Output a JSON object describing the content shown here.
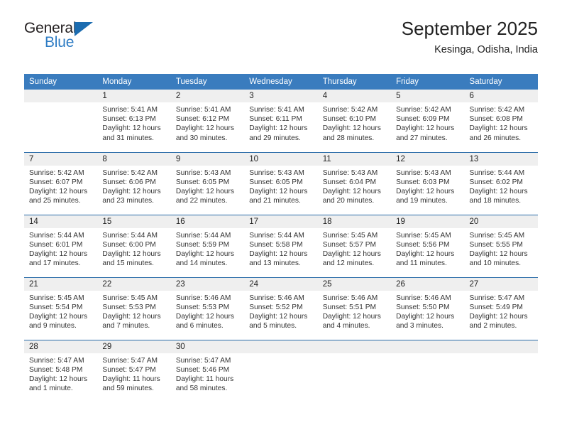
{
  "brand": {
    "name_part1": "General",
    "name_part2": "Blue",
    "triangle_color": "#1b6cb0",
    "blue_color": "#2e7cc4"
  },
  "header": {
    "title": "September 2025",
    "subtitle": "Kesinga, Odisha, India"
  },
  "theme": {
    "header_bg": "#3a7cbe",
    "daynum_bg": "#efefef",
    "week_divider": "#2b6ca8"
  },
  "weekday_headers": [
    "Sunday",
    "Monday",
    "Tuesday",
    "Wednesday",
    "Thursday",
    "Friday",
    "Saturday"
  ],
  "labels": {
    "sunrise_prefix": "Sunrise:",
    "sunset_prefix": "Sunset:",
    "daylight_prefix": "Daylight:"
  },
  "weeks": [
    [
      {
        "day": "",
        "blank": true,
        "l1": "",
        "l2": "",
        "l3": "",
        "l4": ""
      },
      {
        "day": "1",
        "l1": "Sunrise: 5:41 AM",
        "l2": "Sunset: 6:13 PM",
        "l3": "Daylight: 12 hours",
        "l4": "and 31 minutes."
      },
      {
        "day": "2",
        "l1": "Sunrise: 5:41 AM",
        "l2": "Sunset: 6:12 PM",
        "l3": "Daylight: 12 hours",
        "l4": "and 30 minutes."
      },
      {
        "day": "3",
        "l1": "Sunrise: 5:41 AM",
        "l2": "Sunset: 6:11 PM",
        "l3": "Daylight: 12 hours",
        "l4": "and 29 minutes."
      },
      {
        "day": "4",
        "l1": "Sunrise: 5:42 AM",
        "l2": "Sunset: 6:10 PM",
        "l3": "Daylight: 12 hours",
        "l4": "and 28 minutes."
      },
      {
        "day": "5",
        "l1": "Sunrise: 5:42 AM",
        "l2": "Sunset: 6:09 PM",
        "l3": "Daylight: 12 hours",
        "l4": "and 27 minutes."
      },
      {
        "day": "6",
        "l1": "Sunrise: 5:42 AM",
        "l2": "Sunset: 6:08 PM",
        "l3": "Daylight: 12 hours",
        "l4": "and 26 minutes."
      }
    ],
    [
      {
        "day": "7",
        "l1": "Sunrise: 5:42 AM",
        "l2": "Sunset: 6:07 PM",
        "l3": "Daylight: 12 hours",
        "l4": "and 25 minutes."
      },
      {
        "day": "8",
        "l1": "Sunrise: 5:42 AM",
        "l2": "Sunset: 6:06 PM",
        "l3": "Daylight: 12 hours",
        "l4": "and 23 minutes."
      },
      {
        "day": "9",
        "l1": "Sunrise: 5:43 AM",
        "l2": "Sunset: 6:05 PM",
        "l3": "Daylight: 12 hours",
        "l4": "and 22 minutes."
      },
      {
        "day": "10",
        "l1": "Sunrise: 5:43 AM",
        "l2": "Sunset: 6:05 PM",
        "l3": "Daylight: 12 hours",
        "l4": "and 21 minutes."
      },
      {
        "day": "11",
        "l1": "Sunrise: 5:43 AM",
        "l2": "Sunset: 6:04 PM",
        "l3": "Daylight: 12 hours",
        "l4": "and 20 minutes."
      },
      {
        "day": "12",
        "l1": "Sunrise: 5:43 AM",
        "l2": "Sunset: 6:03 PM",
        "l3": "Daylight: 12 hours",
        "l4": "and 19 minutes."
      },
      {
        "day": "13",
        "l1": "Sunrise: 5:44 AM",
        "l2": "Sunset: 6:02 PM",
        "l3": "Daylight: 12 hours",
        "l4": "and 18 minutes."
      }
    ],
    [
      {
        "day": "14",
        "l1": "Sunrise: 5:44 AM",
        "l2": "Sunset: 6:01 PM",
        "l3": "Daylight: 12 hours",
        "l4": "and 17 minutes."
      },
      {
        "day": "15",
        "l1": "Sunrise: 5:44 AM",
        "l2": "Sunset: 6:00 PM",
        "l3": "Daylight: 12 hours",
        "l4": "and 15 minutes."
      },
      {
        "day": "16",
        "l1": "Sunrise: 5:44 AM",
        "l2": "Sunset: 5:59 PM",
        "l3": "Daylight: 12 hours",
        "l4": "and 14 minutes."
      },
      {
        "day": "17",
        "l1": "Sunrise: 5:44 AM",
        "l2": "Sunset: 5:58 PM",
        "l3": "Daylight: 12 hours",
        "l4": "and 13 minutes."
      },
      {
        "day": "18",
        "l1": "Sunrise: 5:45 AM",
        "l2": "Sunset: 5:57 PM",
        "l3": "Daylight: 12 hours",
        "l4": "and 12 minutes."
      },
      {
        "day": "19",
        "l1": "Sunrise: 5:45 AM",
        "l2": "Sunset: 5:56 PM",
        "l3": "Daylight: 12 hours",
        "l4": "and 11 minutes."
      },
      {
        "day": "20",
        "l1": "Sunrise: 5:45 AM",
        "l2": "Sunset: 5:55 PM",
        "l3": "Daylight: 12 hours",
        "l4": "and 10 minutes."
      }
    ],
    [
      {
        "day": "21",
        "l1": "Sunrise: 5:45 AM",
        "l2": "Sunset: 5:54 PM",
        "l3": "Daylight: 12 hours",
        "l4": "and 9 minutes."
      },
      {
        "day": "22",
        "l1": "Sunrise: 5:45 AM",
        "l2": "Sunset: 5:53 PM",
        "l3": "Daylight: 12 hours",
        "l4": "and 7 minutes."
      },
      {
        "day": "23",
        "l1": "Sunrise: 5:46 AM",
        "l2": "Sunset: 5:53 PM",
        "l3": "Daylight: 12 hours",
        "l4": "and 6 minutes."
      },
      {
        "day": "24",
        "l1": "Sunrise: 5:46 AM",
        "l2": "Sunset: 5:52 PM",
        "l3": "Daylight: 12 hours",
        "l4": "and 5 minutes."
      },
      {
        "day": "25",
        "l1": "Sunrise: 5:46 AM",
        "l2": "Sunset: 5:51 PM",
        "l3": "Daylight: 12 hours",
        "l4": "and 4 minutes."
      },
      {
        "day": "26",
        "l1": "Sunrise: 5:46 AM",
        "l2": "Sunset: 5:50 PM",
        "l3": "Daylight: 12 hours",
        "l4": "and 3 minutes."
      },
      {
        "day": "27",
        "l1": "Sunrise: 5:47 AM",
        "l2": "Sunset: 5:49 PM",
        "l3": "Daylight: 12 hours",
        "l4": "and 2 minutes."
      }
    ],
    [
      {
        "day": "28",
        "l1": "Sunrise: 5:47 AM",
        "l2": "Sunset: 5:48 PM",
        "l3": "Daylight: 12 hours",
        "l4": "and 1 minute."
      },
      {
        "day": "29",
        "l1": "Sunrise: 5:47 AM",
        "l2": "Sunset: 5:47 PM",
        "l3": "Daylight: 11 hours",
        "l4": "and 59 minutes."
      },
      {
        "day": "30",
        "l1": "Sunrise: 5:47 AM",
        "l2": "Sunset: 5:46 PM",
        "l3": "Daylight: 11 hours",
        "l4": "and 58 minutes."
      },
      {
        "day": "",
        "blank": true,
        "l1": "",
        "l2": "",
        "l3": "",
        "l4": ""
      },
      {
        "day": "",
        "blank": true,
        "l1": "",
        "l2": "",
        "l3": "",
        "l4": ""
      },
      {
        "day": "",
        "blank": true,
        "l1": "",
        "l2": "",
        "l3": "",
        "l4": ""
      },
      {
        "day": "",
        "blank": true,
        "l1": "",
        "l2": "",
        "l3": "",
        "l4": ""
      }
    ]
  ]
}
